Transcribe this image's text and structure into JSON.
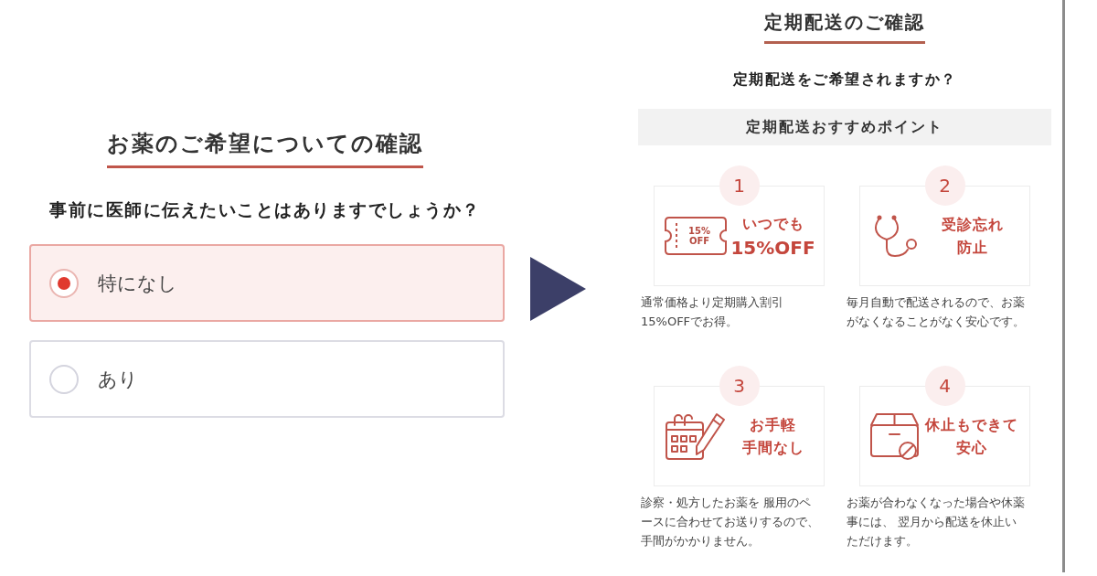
{
  "left_panel": {
    "title": "お薬のご希望についての確認",
    "question": "事前に医師に伝えたいことはありますでしょうか？",
    "options": [
      {
        "label": "特になし",
        "selected": true
      },
      {
        "label": "あり",
        "selected": false
      }
    ]
  },
  "right_panel": {
    "title": "定期配送のご確認",
    "question": "定期配送をご希望されますか？",
    "banner": "定期配送おすすめポイント",
    "points": [
      {
        "number": "1",
        "kind": "coupon",
        "coupon_text": "15%\nOFF",
        "headline": [
          {
            "text": "いつでも",
            "large": false
          },
          {
            "text": "15%OFF",
            "large": true
          }
        ],
        "description": "通常価格より定期購入割引15%OFFでお得。"
      },
      {
        "number": "2",
        "kind": "stethoscope",
        "headline": [
          {
            "text": "受診忘れ",
            "large": false
          },
          {
            "text": "防止",
            "large": false
          }
        ],
        "description": "毎月自動で配送されるので、お薬がなくなることがなく安心です。"
      },
      {
        "number": "3",
        "kind": "calendar",
        "headline": [
          {
            "text": "お手軽",
            "large": false
          },
          {
            "text": "手間なし",
            "large": false
          }
        ],
        "description": "診察・処方したお薬を 服用のペースに合わせてお送りするので、手間がかかりません。"
      },
      {
        "number": "4",
        "kind": "box",
        "headline": [
          {
            "text": "休止もできて",
            "large": false
          },
          {
            "text": "安心",
            "large": false
          }
        ],
        "description": "お薬が合わなくなった場合や休薬事には、 翌月から配送を休止いただけます。"
      }
    ]
  }
}
